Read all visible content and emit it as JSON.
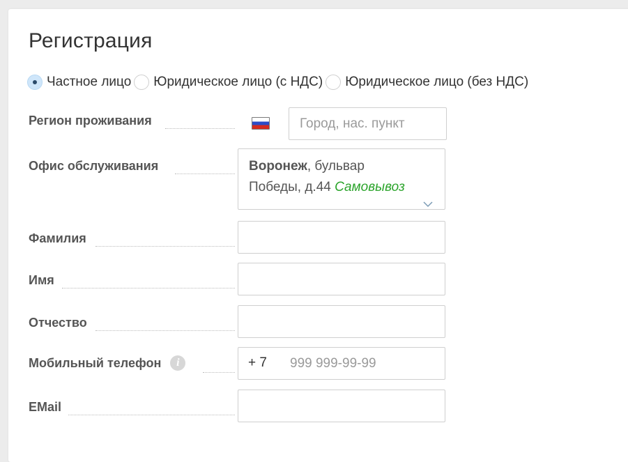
{
  "form": {
    "title": "Регистрация",
    "person_types": [
      {
        "label": "Частное лицо",
        "checked": true
      },
      {
        "label": "Юридическое лицо (с НДС)",
        "checked": false
      },
      {
        "label": "Юридическое лицо (без НДС)",
        "checked": false
      }
    ],
    "fields": {
      "region": {
        "label": "Регион проживания",
        "placeholder": "Город, нас. пункт",
        "value": "",
        "flag_icon": "russia-flag-icon"
      },
      "office": {
        "label": "Офис обслуживания",
        "city": "Воронеж",
        "address_part1": ", бульвар",
        "address_part2": "Победы, д.44",
        "delivery_type": "Самовывоз",
        "dropdown_icon": "chevron-down-icon"
      },
      "last_name": {
        "label": "Фамилия",
        "value": ""
      },
      "first_name": {
        "label": "Имя",
        "value": ""
      },
      "patronymic": {
        "label": "Отчество",
        "value": ""
      },
      "phone": {
        "label": "Мобильный телефон",
        "prefix": "+ 7",
        "placeholder": "999 999-99-99",
        "value": "",
        "info_icon_glyph": "i"
      },
      "email": {
        "label": "EMail",
        "value": ""
      }
    }
  },
  "colors": {
    "accent_green": "#2ba42b",
    "radio_checked": "#cfe6fa"
  }
}
